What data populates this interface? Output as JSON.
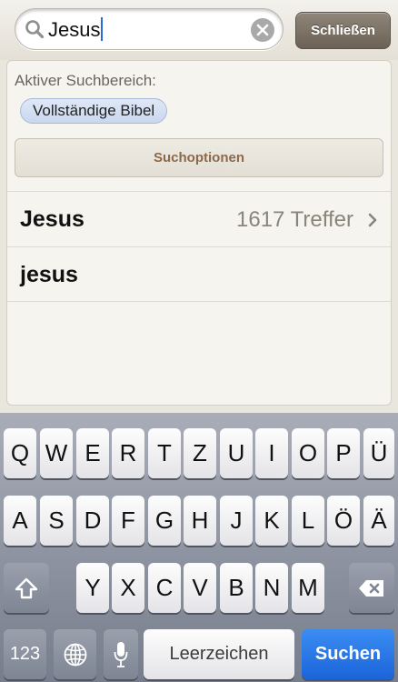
{
  "search": {
    "query": "Jesus",
    "close_label": "Schließen"
  },
  "scope": {
    "label": "Aktiver Suchbereich:",
    "selected": "Vollständige Bibel"
  },
  "options_label": "Suchoptionen",
  "results": [
    {
      "term": "Jesus",
      "count": "1617 Treffer"
    },
    {
      "term": "jesus",
      "count": ""
    }
  ],
  "keyboard": {
    "row1": [
      "Q",
      "W",
      "E",
      "R",
      "T",
      "Z",
      "U",
      "I",
      "O",
      "P",
      "Ü"
    ],
    "row2": [
      "A",
      "S",
      "D",
      "F",
      "G",
      "H",
      "J",
      "K",
      "L",
      "Ö",
      "Ä"
    ],
    "row3": [
      "Y",
      "X",
      "C",
      "V",
      "B",
      "N",
      "M"
    ],
    "numbers_label": "123",
    "space_label": "Leerzeichen",
    "search_label": "Suchen",
    "icons": {
      "shift": "shift-icon",
      "backspace": "backspace-icon",
      "globe": "globe-icon",
      "mic": "microphone-icon"
    }
  },
  "colors": {
    "accent_blue": "#1b64d9",
    "chip_blue": "#c9d7ef",
    "options_text": "#8b6a4a"
  }
}
